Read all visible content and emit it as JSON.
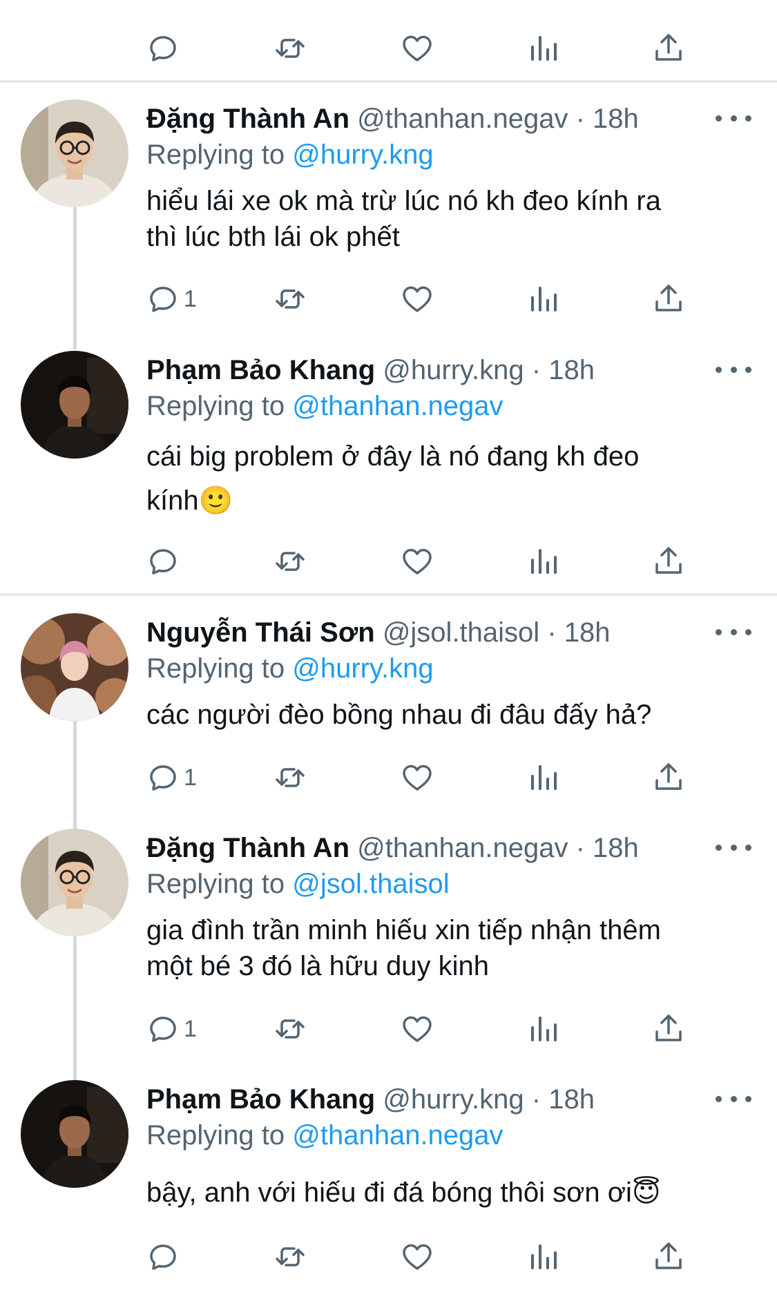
{
  "colors": {
    "accent": "#1d9bf0",
    "muted": "#536471",
    "text": "#0f1419",
    "divider": "#e6e9ec",
    "thread": "#cfd9de"
  },
  "icons": [
    "reply-icon",
    "retweet-icon",
    "like-icon",
    "analytics-icon",
    "share-icon",
    "more-icon"
  ],
  "top_actions": {
    "reply_count": ""
  },
  "tweets": [
    {
      "name": "Đặng Thành An",
      "handle": "@thanhan.negav",
      "dot": "·",
      "time": "18h",
      "replying_label": "Replying to",
      "replying_to": "@hurry.kng",
      "text": "hiểu lái xe ok mà trừ lúc nó kh đeo kính ra\nthì lúc bth lái ok phết",
      "reply_count": "1"
    },
    {
      "name": "Phạm Bảo Khang",
      "handle": "@hurry.kng",
      "dot": "·",
      "time": "18h",
      "replying_label": "Replying to",
      "replying_to": "@thanhan.negav",
      "text": "cái big problem ở đây là nó đang kh đeo\nkính🙂",
      "reply_count": ""
    },
    {
      "name": "Nguyễn Thái Sơn",
      "handle": "@jsol.thaisol",
      "dot": "·",
      "time": "18h",
      "replying_label": "Replying to",
      "replying_to": "@hurry.kng",
      "text": "các người đèo bồng nhau đi đâu đấy hả?",
      "reply_count": "1"
    },
    {
      "name": "Đặng Thành An",
      "handle": "@thanhan.negav",
      "dot": "·",
      "time": "18h",
      "replying_label": "Replying to",
      "replying_to": "@jsol.thaisol",
      "text": "gia đình trần minh hiếu xin tiếp nhận thêm\nmột bé 3 đó là hữu duy kinh",
      "reply_count": "1"
    },
    {
      "name": "Phạm Bảo Khang",
      "handle": "@hurry.kng",
      "dot": "·",
      "time": "18h",
      "replying_label": "Replying to",
      "replying_to": "@thanhan.negav",
      "text": "bậy, anh với hiếu đi đá bóng thôi sơn ơi😇",
      "reply_count": ""
    }
  ]
}
